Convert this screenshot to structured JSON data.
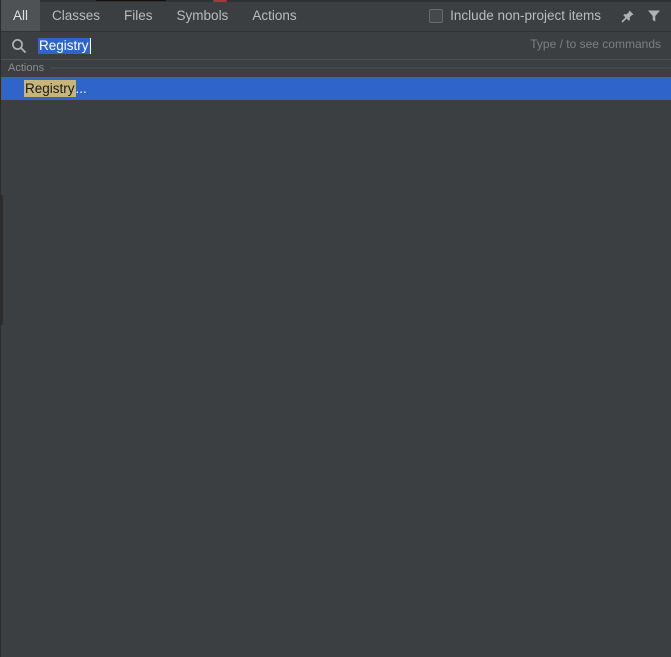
{
  "tabs": [
    {
      "label": "All",
      "active": true
    },
    {
      "label": "Classes",
      "active": false
    },
    {
      "label": "Files",
      "active": false
    },
    {
      "label": "Symbols",
      "active": false
    },
    {
      "label": "Actions",
      "active": false
    }
  ],
  "options": {
    "include_non_project_label": "Include non-project items",
    "include_non_project_checked": false,
    "pin_icon": "pin-icon",
    "filter_icon": "filter-icon"
  },
  "search": {
    "icon": "search-icon",
    "query": "Registry",
    "hint": "Type / to see commands"
  },
  "results": {
    "group_label": "Actions",
    "items": [
      {
        "match": "Registry",
        "rest": "...",
        "selected": true
      }
    ]
  },
  "colors": {
    "background": "#3c3f41",
    "selection": "#2f65ca",
    "match_highlight": "#c7b57a"
  }
}
